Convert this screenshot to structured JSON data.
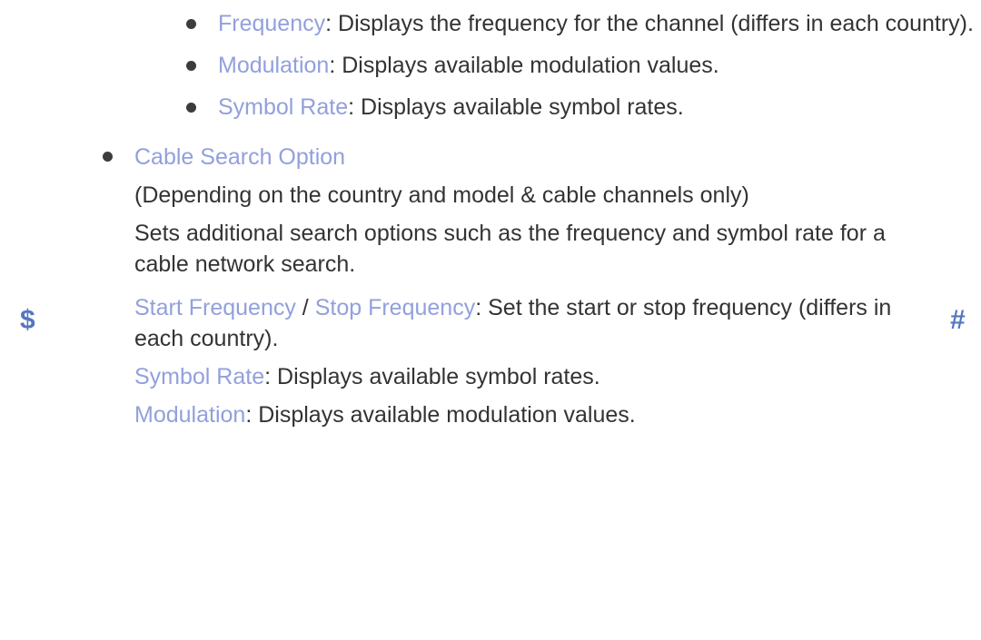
{
  "margin": {
    "left_glyph": "$",
    "right_glyph": "#",
    "glyph_color": "#5576c0"
  },
  "theme": {
    "term_color": "#92a0dc",
    "body_color": "#333333",
    "bullet_color": "#3c3c3c",
    "background": "#ffffff"
  },
  "sub_bullets": [
    {
      "term": "Frequency",
      "separator": ": ",
      "description": "Displays the frequency for the channel (differs in each country)."
    },
    {
      "term": "Modulation",
      "separator": ": ",
      "description": "Displays available modulation values."
    },
    {
      "term": "Symbol Rate",
      "separator": ": ",
      "description": "Displays available symbol rates."
    }
  ],
  "section": {
    "heading": "Cable Search Option",
    "note": "(Depending on the country and model & cable channels only)",
    "description": "Sets additional search options such as the frequency and symbol rate for a cable network search.",
    "options": [
      {
        "term_a": "Start Frequency",
        "term_divider": " / ",
        "term_b": "Stop Frequency",
        "separator": ": ",
        "description": "Set the start or stop frequency (differs in each country)."
      },
      {
        "term_a": "Symbol Rate",
        "separator": ": ",
        "description": "Displays available symbol rates."
      },
      {
        "term_a": "Modulation",
        "separator": ": ",
        "description": "Displays available modulation values."
      }
    ]
  }
}
